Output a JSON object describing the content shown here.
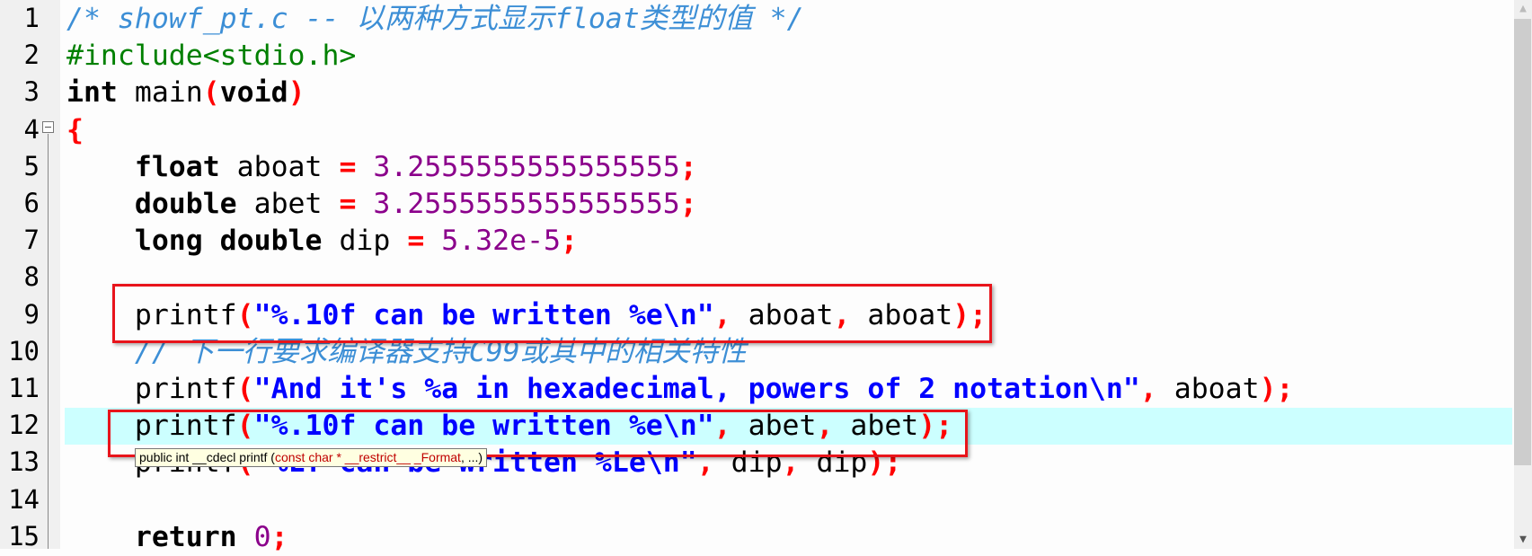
{
  "editor": {
    "current_line": 12,
    "colors": {
      "comment": "#3d8fd6",
      "preprocessor": "#008000",
      "string": "#0000ff",
      "number": "#8b008b",
      "operator": "#ff0000",
      "current_line_bg": "#ccffff",
      "annotation_box": "#e8141b"
    },
    "lines": [
      {
        "num": "1",
        "tokens": [
          {
            "t": "comment",
            "v": "/* showf_pt.c -- 以两种方式显示float类型的值 */"
          }
        ]
      },
      {
        "num": "2",
        "tokens": [
          {
            "t": "pre",
            "v": "#include<stdio.h>"
          }
        ]
      },
      {
        "num": "3",
        "tokens": [
          {
            "t": "kw",
            "v": "int"
          },
          {
            "t": "id",
            "v": " main"
          },
          {
            "t": "paren",
            "v": "("
          },
          {
            "t": "kw",
            "v": "void"
          },
          {
            "t": "paren",
            "v": ")"
          }
        ]
      },
      {
        "num": "4",
        "tokens": [
          {
            "t": "paren",
            "v": "{"
          }
        ]
      },
      {
        "num": "5",
        "tokens": [
          {
            "t": "id",
            "v": "    "
          },
          {
            "t": "kw",
            "v": "float"
          },
          {
            "t": "id",
            "v": " aboat "
          },
          {
            "t": "op",
            "v": "="
          },
          {
            "t": "id",
            "v": " "
          },
          {
            "t": "num",
            "v": "3.2555555555555555"
          },
          {
            "t": "op",
            "v": ";"
          }
        ]
      },
      {
        "num": "6",
        "tokens": [
          {
            "t": "id",
            "v": "    "
          },
          {
            "t": "kw",
            "v": "double"
          },
          {
            "t": "id",
            "v": " abet "
          },
          {
            "t": "op",
            "v": "="
          },
          {
            "t": "id",
            "v": " "
          },
          {
            "t": "num",
            "v": "3.2555555555555555"
          },
          {
            "t": "op",
            "v": ";"
          }
        ]
      },
      {
        "num": "7",
        "tokens": [
          {
            "t": "id",
            "v": "    "
          },
          {
            "t": "kw",
            "v": "long double"
          },
          {
            "t": "id",
            "v": " dip "
          },
          {
            "t": "op",
            "v": "="
          },
          {
            "t": "id",
            "v": " "
          },
          {
            "t": "num",
            "v": "5.32e-5"
          },
          {
            "t": "op",
            "v": ";"
          }
        ]
      },
      {
        "num": "8",
        "tokens": []
      },
      {
        "num": "9",
        "tokens": [
          {
            "t": "id",
            "v": "    printf"
          },
          {
            "t": "paren",
            "v": "("
          },
          {
            "t": "str",
            "v": "\"%.10f can be written %e\\n\""
          },
          {
            "t": "op",
            "v": ","
          },
          {
            "t": "id",
            "v": " aboat"
          },
          {
            "t": "op",
            "v": ","
          },
          {
            "t": "id",
            "v": " aboat"
          },
          {
            "t": "paren",
            "v": ")"
          },
          {
            "t": "op",
            "v": ";"
          }
        ]
      },
      {
        "num": "10",
        "tokens": [
          {
            "t": "id",
            "v": "    "
          },
          {
            "t": "comment",
            "v": "// 下一行要求编译器支持C99或其中的相关特性"
          }
        ]
      },
      {
        "num": "11",
        "tokens": [
          {
            "t": "id",
            "v": "    printf"
          },
          {
            "t": "paren",
            "v": "("
          },
          {
            "t": "str",
            "v": "\"And it's %a in hexadecimal, powers of 2 notation\\n\""
          },
          {
            "t": "op",
            "v": ","
          },
          {
            "t": "id",
            "v": " aboat"
          },
          {
            "t": "paren",
            "v": ")"
          },
          {
            "t": "op",
            "v": ";"
          }
        ]
      },
      {
        "num": "12",
        "tokens": [
          {
            "t": "id",
            "v": "    printf"
          },
          {
            "t": "paren",
            "v": "("
          },
          {
            "t": "str",
            "v": "\"%.10f can be written %e\\n\""
          },
          {
            "t": "op",
            "v": ","
          },
          {
            "t": "id",
            "v": " abet"
          },
          {
            "t": "op",
            "v": ","
          },
          {
            "t": "id",
            "v": " abet"
          },
          {
            "t": "paren",
            "v": ")"
          },
          {
            "t": "op",
            "v": ";"
          }
        ]
      },
      {
        "num": "13",
        "tokens": [
          {
            "t": "id",
            "v": "    printf"
          },
          {
            "t": "paren",
            "v": "("
          },
          {
            "t": "str",
            "v": "\"%Lf can be written %Le\\n\""
          },
          {
            "t": "op",
            "v": ","
          },
          {
            "t": "id",
            "v": " dip"
          },
          {
            "t": "op",
            "v": ","
          },
          {
            "t": "id",
            "v": " dip"
          },
          {
            "t": "paren",
            "v": ")"
          },
          {
            "t": "op",
            "v": ";"
          }
        ]
      },
      {
        "num": "14",
        "tokens": []
      },
      {
        "num": "15",
        "tokens": [
          {
            "t": "id",
            "v": "    "
          },
          {
            "t": "kw",
            "v": "return"
          },
          {
            "t": "id",
            "v": " "
          },
          {
            "t": "num",
            "v": "0"
          },
          {
            "t": "op",
            "v": ";"
          }
        ]
      }
    ]
  },
  "tooltip": {
    "prefix": "public int __cdecl printf (",
    "param": "const char * __restrict__ _Format",
    "suffix": ", ...)"
  },
  "scrollbar": {
    "up_icon": "chevron-up-icon",
    "down_icon": "chevron-down-icon"
  }
}
